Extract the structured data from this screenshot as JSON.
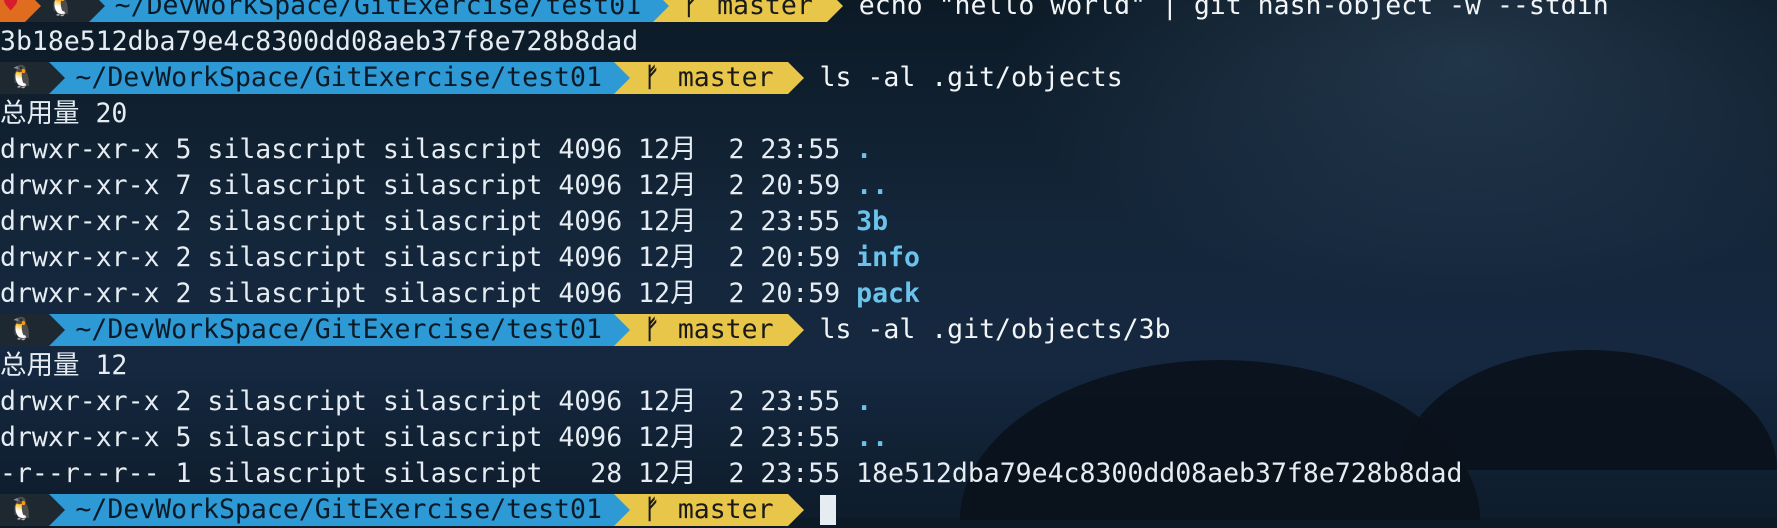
{
  "prompt": {
    "status_icon": "heart-icon",
    "user_icon": "linux-penguin-icon",
    "path": "~/DevWorkSpace/GitExercise/test01",
    "branch_icon": "git-branch-icon",
    "branch": "master"
  },
  "commands": [
    {
      "text": "echo \"hello world\" | git hash-object -w --stdin"
    },
    {
      "text": "ls -al .git/objects"
    },
    {
      "text": "ls -al .git/objects/3b"
    }
  ],
  "outputs": {
    "hash": "3b18e512dba79e4c8300dd08aeb37f8e728b8dad",
    "total1": "总用量 20",
    "listing1": [
      {
        "perm": "drwxr-xr-x 5 silascript silascript 4096 12月  2 23:55 ",
        "name": "."
      },
      {
        "perm": "drwxr-xr-x 7 silascript silascript 4096 12月  2 20:59 ",
        "name": ".."
      },
      {
        "perm": "drwxr-xr-x 2 silascript silascript 4096 12月  2 23:55 ",
        "name": "3b"
      },
      {
        "perm": "drwxr-xr-x 2 silascript silascript 4096 12月  2 20:59 ",
        "name": "info"
      },
      {
        "perm": "drwxr-xr-x 2 silascript silascript 4096 12月  2 20:59 ",
        "name": "pack"
      }
    ],
    "total2": "总用量 12",
    "listing2": [
      {
        "perm": "drwxr-xr-x 2 silascript silascript 4096 12月  2 23:55 ",
        "name": "."
      },
      {
        "perm": "drwxr-xr-x 5 silascript silascript 4096 12月  2 23:55 ",
        "name": ".."
      },
      {
        "perm": "-r--r--r-- 1 silascript silascript   28 12月  2 23:55 ",
        "name": "18e512dba79e4c8300dd08aeb37f8e728b8dad"
      }
    ]
  },
  "colors": {
    "status_bg": "#e06c1f",
    "path_bg": "#2d9ad6",
    "branch_bg": "#e8c64a",
    "dir_color": "#6bc3ec"
  }
}
